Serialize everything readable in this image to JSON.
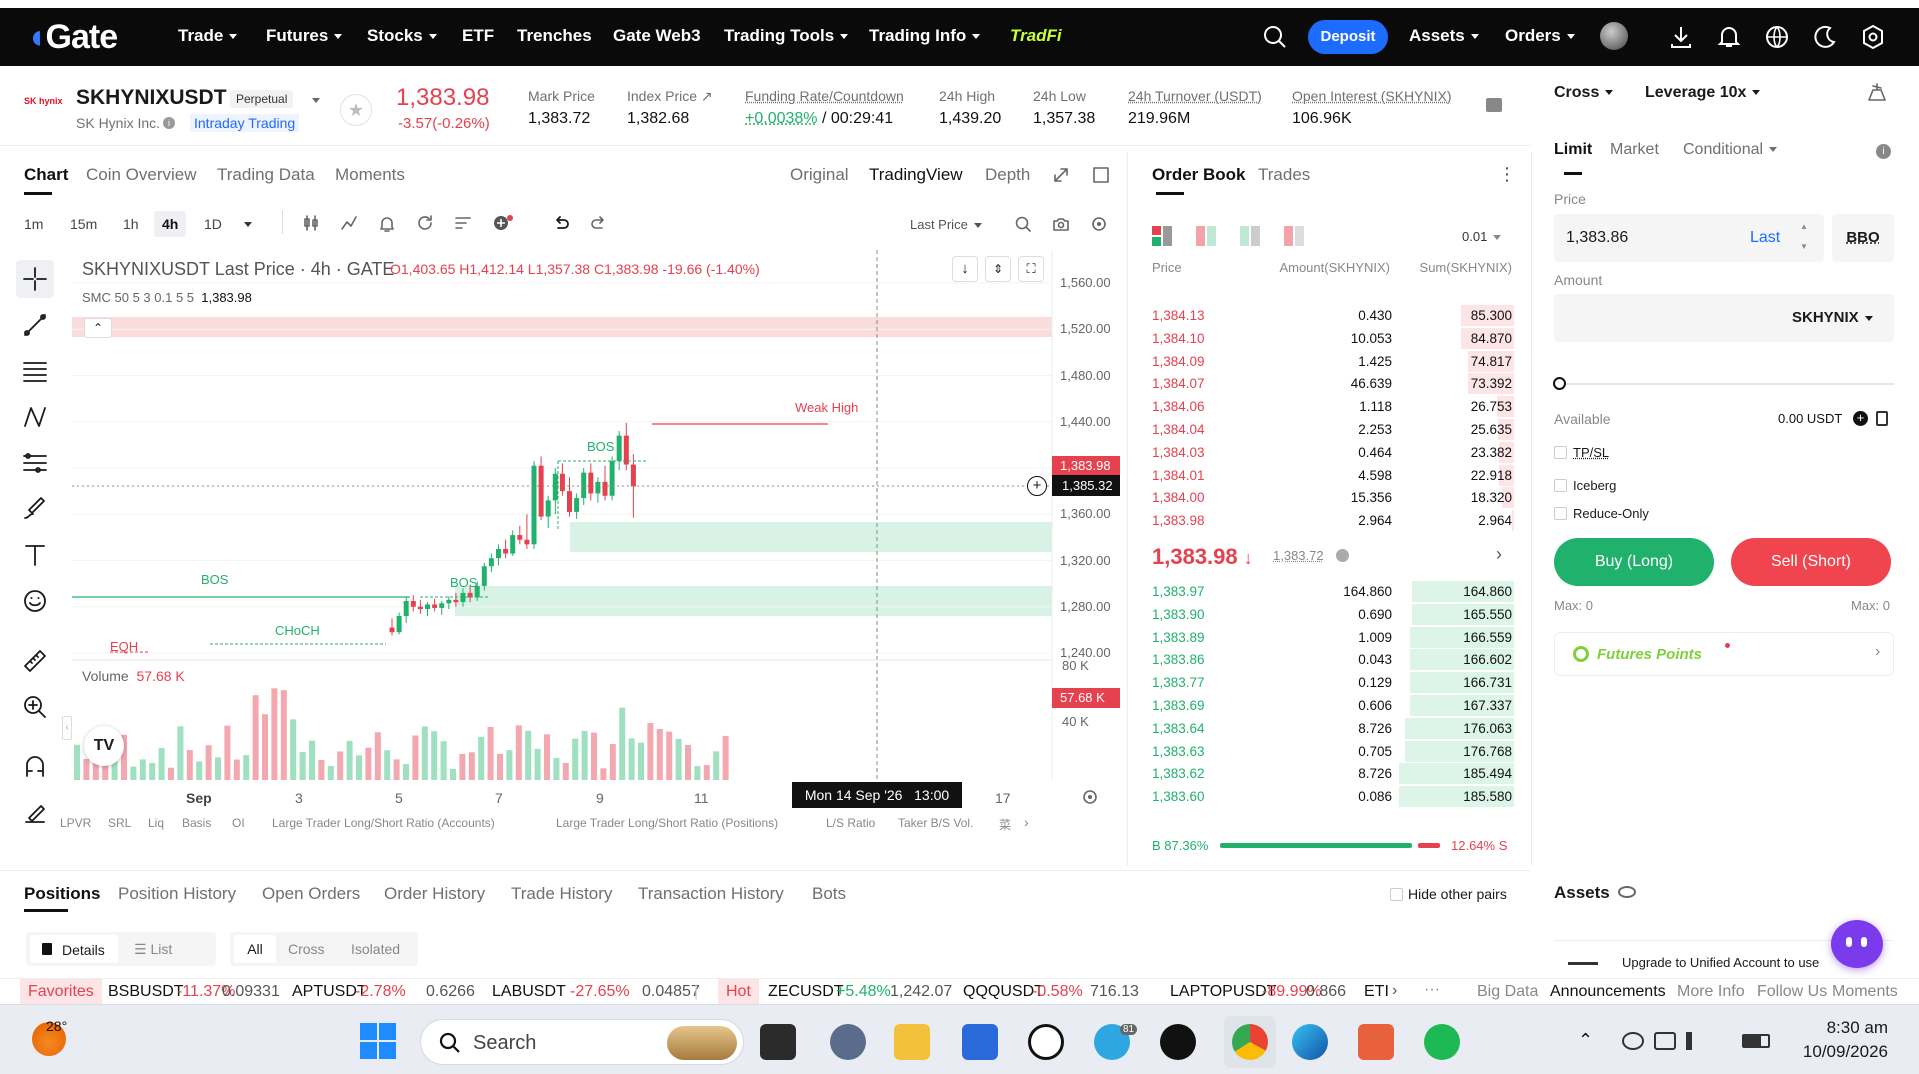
{
  "nav": {
    "logo": "Gate",
    "items": [
      {
        "label": "Trade",
        "caret": true
      },
      {
        "label": "Futures",
        "caret": true
      },
      {
        "label": "Stocks",
        "caret": true
      },
      {
        "label": "ETF",
        "caret": false
      },
      {
        "label": "Trenches",
        "caret": false
      },
      {
        "label": "Gate Web3",
        "caret": false
      },
      {
        "label": "Trading Tools",
        "caret": true
      },
      {
        "label": "Trading Info",
        "caret": true
      },
      {
        "label": "TradFi",
        "caret": false
      }
    ],
    "deposit": "Deposit",
    "assets": "Assets",
    "orders": "Orders"
  },
  "ticker": {
    "logo_text": "SK hynix",
    "symbol": "SKHYNIXUSDT",
    "badge": "Perpetual",
    "company": "SK Hynix Inc.",
    "intraday": "Intraday Trading",
    "last_price": "1,383.98",
    "change": "-3.57(-0.26%)",
    "stats": [
      {
        "label": "Mark Price",
        "value": "1,383.72"
      },
      {
        "label": "Index Price ↗",
        "value": "1,382.68"
      },
      {
        "label": "Funding Rate/Countdown",
        "value": "+0.0038%",
        "value2": " / 00:29:41"
      },
      {
        "label": "24h High",
        "value": "1,439.20"
      },
      {
        "label": "24h Low",
        "value": "1,357.38"
      },
      {
        "label": "24h Turnover (USDT)",
        "value": "219.96M"
      },
      {
        "label": "Open Interest (SKHYNIX)",
        "value": "106.96K"
      }
    ]
  },
  "chart_tabs": {
    "items": [
      "Chart",
      "Coin Overview",
      "Trading Data",
      "Moments"
    ],
    "views": [
      "Original",
      "TradingView",
      "Depth"
    ]
  },
  "toolbar": {
    "timeframes": [
      "1m",
      "15m",
      "1h",
      "4h",
      "1D"
    ],
    "last_price_sel": "Last Price"
  },
  "chart_data": {
    "type": "candlestick",
    "title": "SKHYNIXUSDT Last Price · 4h · GATE",
    "ohlc_line": {
      "o": "O1,403.65",
      "h": "H1,412.14",
      "l": "L1,357.38",
      "c": "C1,383.98",
      "chg": "-19.66 (-1.40%)"
    },
    "smc_line": {
      "label": "SMC 50 5 3 0.1 5 5",
      "value": "1,383.98"
    },
    "y_ticks": [
      "1,560.00",
      "1,520.00",
      "1,480.00",
      "1,440.00",
      "1,400.00",
      "1,360.00",
      "1,320.00",
      "1,280.00",
      "1,240.00"
    ],
    "y_range": [
      1240,
      1560
    ],
    "price_tag": "1,383.98",
    "cross_tag": "1,385.32",
    "x_ticks": [
      "Sep",
      "3",
      "5",
      "7",
      "9",
      "11",
      "17"
    ],
    "crosshair_time": "Mon 14 Sep '26   13:00",
    "annotations": {
      "weak_high": "Weak High",
      "bos": "BOS",
      "choch": "CHoCH",
      "eqh": "EQH"
    },
    "volume": {
      "label": "Volume",
      "value": "57.68 K",
      "ticks": [
        "80 K",
        "40 K"
      ],
      "tag": "57.68 K"
    },
    "candles": [
      {
        "o": 1262,
        "h": 1270,
        "l": 1255,
        "c": 1258
      },
      {
        "o": 1258,
        "h": 1275,
        "l": 1256,
        "c": 1272
      },
      {
        "o": 1272,
        "h": 1288,
        "l": 1266,
        "c": 1285
      },
      {
        "o": 1285,
        "h": 1290,
        "l": 1276,
        "c": 1280
      },
      {
        "o": 1280,
        "h": 1286,
        "l": 1274,
        "c": 1278
      },
      {
        "o": 1278,
        "h": 1284,
        "l": 1272,
        "c": 1282
      },
      {
        "o": 1282,
        "h": 1287,
        "l": 1276,
        "c": 1279
      },
      {
        "o": 1279,
        "h": 1285,
        "l": 1273,
        "c": 1283
      },
      {
        "o": 1283,
        "h": 1289,
        "l": 1278,
        "c": 1286
      },
      {
        "o": 1286,
        "h": 1292,
        "l": 1280,
        "c": 1284
      },
      {
        "o": 1284,
        "h": 1296,
        "l": 1280,
        "c": 1292
      },
      {
        "o": 1292,
        "h": 1298,
        "l": 1284,
        "c": 1288
      },
      {
        "o": 1288,
        "h": 1302,
        "l": 1285,
        "c": 1298
      },
      {
        "o": 1298,
        "h": 1318,
        "l": 1294,
        "c": 1315
      },
      {
        "o": 1315,
        "h": 1326,
        "l": 1310,
        "c": 1322
      },
      {
        "o": 1322,
        "h": 1334,
        "l": 1316,
        "c": 1330
      },
      {
        "o": 1330,
        "h": 1338,
        "l": 1322,
        "c": 1326
      },
      {
        "o": 1326,
        "h": 1346,
        "l": 1324,
        "c": 1342
      },
      {
        "o": 1342,
        "h": 1350,
        "l": 1334,
        "c": 1338
      },
      {
        "o": 1338,
        "h": 1360,
        "l": 1330,
        "c": 1334
      },
      {
        "o": 1334,
        "h": 1406,
        "l": 1330,
        "c": 1402
      },
      {
        "o": 1402,
        "h": 1410,
        "l": 1355,
        "c": 1358
      },
      {
        "o": 1358,
        "h": 1376,
        "l": 1348,
        "c": 1372
      },
      {
        "o": 1372,
        "h": 1400,
        "l": 1360,
        "c": 1395
      },
      {
        "o": 1395,
        "h": 1404,
        "l": 1376,
        "c": 1380
      },
      {
        "o": 1380,
        "h": 1392,
        "l": 1358,
        "c": 1362
      },
      {
        "o": 1362,
        "h": 1378,
        "l": 1356,
        "c": 1374
      },
      {
        "o": 1374,
        "h": 1400,
        "l": 1368,
        "c": 1396
      },
      {
        "o": 1396,
        "h": 1404,
        "l": 1372,
        "c": 1378
      },
      {
        "o": 1378,
        "h": 1392,
        "l": 1370,
        "c": 1388
      },
      {
        "o": 1388,
        "h": 1402,
        "l": 1372,
        "c": 1376
      },
      {
        "o": 1376,
        "h": 1410,
        "l": 1372,
        "c": 1406
      },
      {
        "o": 1406,
        "h": 1432,
        "l": 1398,
        "c": 1428
      },
      {
        "o": 1428,
        "h": 1439,
        "l": 1398,
        "c": 1403
      },
      {
        "o": 1403,
        "h": 1412,
        "l": 1357,
        "c": 1384
      }
    ]
  },
  "indicators": [
    "LPVR",
    "SRL",
    "Liq",
    "Basis",
    "OI",
    "Large Trader Long/Short Ratio (Accounts)",
    "Large Trader Long/Short Ratio (Positions)",
    "L/S Ratio",
    "Taker B/S Vol.",
    "菜"
  ],
  "orderbook": {
    "tabs": [
      "Order Book",
      "Trades"
    ],
    "precision": "0.01",
    "headers": [
      "Price",
      "Amount(SKHYNIX)",
      "Sum(SKHYNIX)"
    ],
    "asks": [
      {
        "p": "1,384.13",
        "a": "0.430",
        "s": "85.300",
        "f": 0.46
      },
      {
        "p": "1,384.10",
        "a": "10.053",
        "s": "84.870",
        "f": 0.46
      },
      {
        "p": "1,384.09",
        "a": "1.425",
        "s": "74.817",
        "f": 0.4
      },
      {
        "p": "1,384.07",
        "a": "46.639",
        "s": "73.392",
        "f": 0.4
      },
      {
        "p": "1,384.06",
        "a": "1.118",
        "s": "26.753",
        "f": 0.15
      },
      {
        "p": "1,384.04",
        "a": "2.253",
        "s": "25.635",
        "f": 0.14
      },
      {
        "p": "1,384.03",
        "a": "0.464",
        "s": "23.382",
        "f": 0.13
      },
      {
        "p": "1,384.01",
        "a": "4.598",
        "s": "22.918",
        "f": 0.13
      },
      {
        "p": "1,384.00",
        "a": "15.356",
        "s": "18.320",
        "f": 0.1
      },
      {
        "p": "1,383.98",
        "a": "2.964",
        "s": "2.964",
        "f": 0.02
      }
    ],
    "mid": {
      "price": "1,383.98",
      "arrow": "↓",
      "mark": "1,383.72"
    },
    "bids": [
      {
        "p": "1,383.97",
        "a": "164.860",
        "s": "164.860",
        "f": 0.89
      },
      {
        "p": "1,383.90",
        "a": "0.690",
        "s": "165.550",
        "f": 0.89
      },
      {
        "p": "1,383.89",
        "a": "1.009",
        "s": "166.559",
        "f": 0.9
      },
      {
        "p": "1,383.86",
        "a": "0.043",
        "s": "166.602",
        "f": 0.9
      },
      {
        "p": "1,383.77",
        "a": "0.129",
        "s": "166.731",
        "f": 0.9
      },
      {
        "p": "1,383.69",
        "a": "0.606",
        "s": "167.337",
        "f": 0.9
      },
      {
        "p": "1,383.64",
        "a": "8.726",
        "s": "176.063",
        "f": 0.95
      },
      {
        "p": "1,383.63",
        "a": "0.705",
        "s": "176.768",
        "f": 0.95
      },
      {
        "p": "1,383.62",
        "a": "8.726",
        "s": "185.494",
        "f": 1.0
      },
      {
        "p": "1,383.60",
        "a": "0.086",
        "s": "185.580",
        "f": 1.0
      }
    ],
    "ratio": {
      "b_label": "B 87.36%",
      "s_label": "12.64% S",
      "b_pct": 87.36
    }
  },
  "form": {
    "margin_mode": "Cross",
    "leverage": "Leverage 10x",
    "tabs": [
      "Limit",
      "Market",
      "Conditional"
    ],
    "price_label": "Price",
    "price_value": "1,383.86",
    "last": "Last",
    "bbo": "BBO",
    "amount_label": "Amount",
    "amount_unit": "SKHYNIX",
    "available_label": "Available",
    "available_value": "0.00 USDT",
    "tpsl": "TP/SL",
    "iceberg": "Iceberg",
    "reduce_only": "Reduce-Only",
    "buy": "Buy (Long)",
    "sell": "Sell (Short)",
    "max_buy": "Max: 0",
    "max_sell": "Max: 0",
    "futures_points": "Futures Points",
    "assets_title": "Assets",
    "upgrade": "Upgrade to Unified Account to use"
  },
  "bottom": {
    "tabs": [
      "Positions",
      "Position History",
      "Open Orders",
      "Order History",
      "Trade History",
      "Transaction History",
      "Bots"
    ],
    "hide_pairs": "Hide other pairs",
    "view_details": "Details",
    "view_list": "List",
    "filters": [
      "All",
      "Cross",
      "Isolated"
    ]
  },
  "tape": {
    "favorites": "Favorites",
    "items1": [
      {
        "sym": "BSBUSDT",
        "chg": "-11.37%",
        "px": "0.09331"
      },
      {
        "sym": "APTUSDT",
        "chg": "-2.78%",
        "px": "0.6266"
      },
      {
        "sym": "LABUSDT",
        "chg": "-27.65%",
        "px": "0.04857"
      }
    ],
    "hot": "Hot",
    "items2": [
      {
        "sym": "ZECUSDT",
        "chg": "+5.48%",
        "px": "1,242.07",
        "up": true
      },
      {
        "sym": "QQQUSDT",
        "chg": "-0.58%",
        "px": "716.13"
      },
      {
        "sym": "LAPTOPUSDT",
        "chg": "-89.99%",
        "px": "0.866"
      },
      {
        "sym": "ETI",
        "chg": "",
        "px": ""
      }
    ],
    "right": [
      "Big Data",
      "Announcements",
      "More Info",
      "Follow Us",
      "Moments"
    ]
  },
  "taskbar": {
    "weather": "28°",
    "search": "Search",
    "time": "8:30 am",
    "date": "10/09/2026",
    "telegram_badge": "81"
  }
}
